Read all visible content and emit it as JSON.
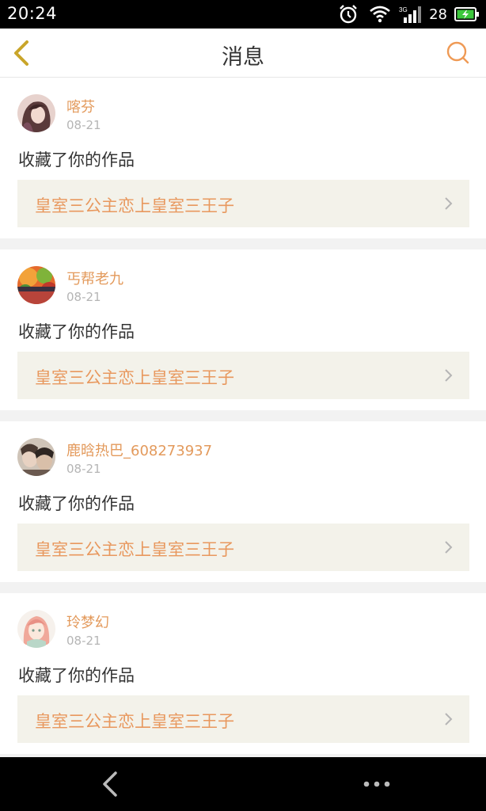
{
  "status_bar": {
    "time": "20:24",
    "battery_level": "28",
    "icons": [
      "alarm-icon",
      "wifi-icon",
      "signal-3g-icon",
      "battery-charging-icon"
    ]
  },
  "header": {
    "title": "消息",
    "back_icon": "chevron-left-icon",
    "search_icon": "search-icon"
  },
  "messages": [
    {
      "user": "喀芬",
      "date": "08-21",
      "action": "收藏了你的作品",
      "work_title": "皇室三公主恋上皇室三王子"
    },
    {
      "user": "丐帮老九",
      "date": "08-21",
      "action": "收藏了你的作品",
      "work_title": "皇室三公主恋上皇室三王子"
    },
    {
      "user": "鹿晗热巴_608273937",
      "date": "08-21",
      "action": "收藏了你的作品",
      "work_title": "皇室三公主恋上皇室三王子"
    },
    {
      "user": "玲梦幻",
      "date": "08-21",
      "action": "收藏了你的作品",
      "work_title": "皇室三公主恋上皇室三王子"
    }
  ],
  "nav_bar": {
    "icons": [
      "back-icon",
      "more-icon"
    ]
  },
  "colors": {
    "accent": "#e8985e",
    "username": "#e39a5c",
    "work_bg": "#f3f2ea",
    "page_bg": "#f2f2f2"
  }
}
